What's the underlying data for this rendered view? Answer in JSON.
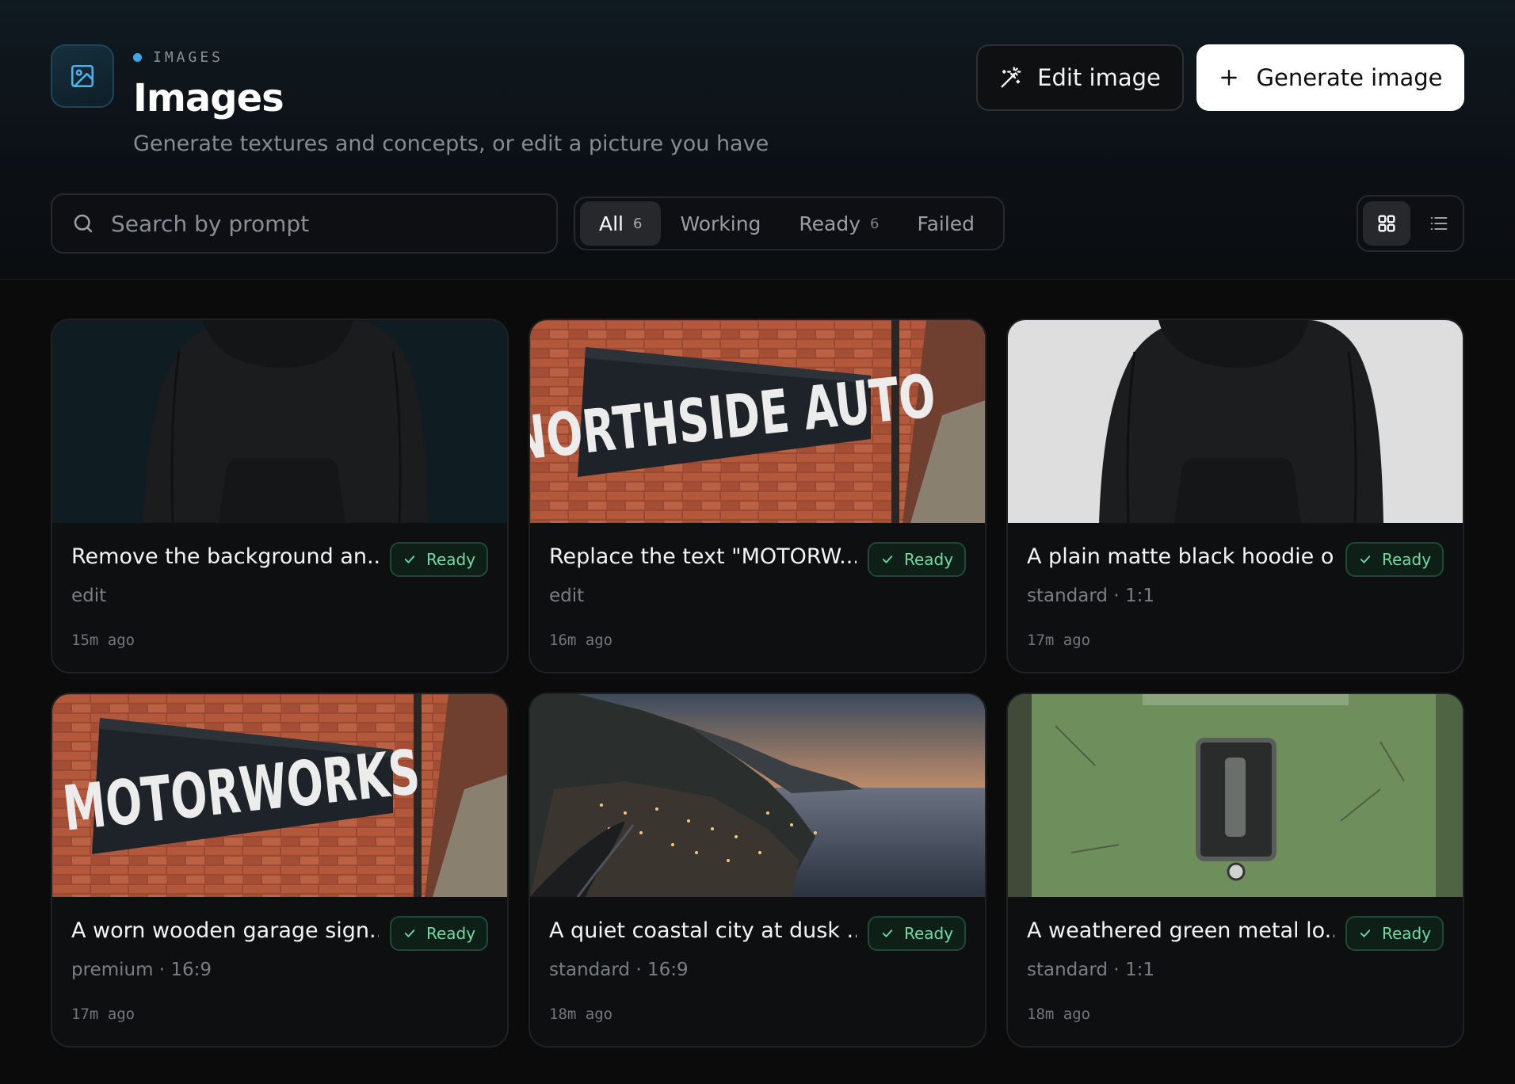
{
  "header": {
    "eyebrow": "IMAGES",
    "title": "Images",
    "subtitle": "Generate textures and concepts, or edit a picture you have",
    "edit_button": "Edit image",
    "generate_button": "Generate image"
  },
  "search": {
    "placeholder": "Search by prompt"
  },
  "filters": [
    {
      "label": "All",
      "count": "6"
    },
    {
      "label": "Working",
      "count": ""
    },
    {
      "label": "Ready",
      "count": "6"
    },
    {
      "label": "Failed",
      "count": ""
    }
  ],
  "cards": [
    {
      "title": "Remove the background an...",
      "status": "Ready",
      "meta": "edit",
      "time": "15m ago",
      "image": "black-hoodie-dark-bg"
    },
    {
      "title": "Replace the text \"MOTORW...",
      "status": "Ready",
      "meta": "edit",
      "time": "16m ago",
      "image": "northside-auto-sign",
      "sign_text": "NORTHSIDE AUTO"
    },
    {
      "title": "A plain matte black hoodie o...",
      "status": "Ready",
      "meta": "standard · 1:1",
      "time": "17m ago",
      "image": "black-hoodie-light-bg"
    },
    {
      "title": "A worn wooden garage sign...",
      "status": "Ready",
      "meta": "premium · 16:9",
      "time": "17m ago",
      "image": "motorworks-sign",
      "sign_text": "MOTORWORKS"
    },
    {
      "title": "A quiet coastal city at dusk ...",
      "status": "Ready",
      "meta": "standard · 16:9",
      "time": "18m ago",
      "image": "coastal-city-dusk"
    },
    {
      "title": "A weathered green metal lo...",
      "status": "Ready",
      "meta": "standard · 1:1",
      "time": "18m ago",
      "image": "green-metal-locker"
    }
  ],
  "colors": {
    "accent": "#3aa7e6",
    "ready": "#6fdba2",
    "background": "#0b0b0c"
  }
}
